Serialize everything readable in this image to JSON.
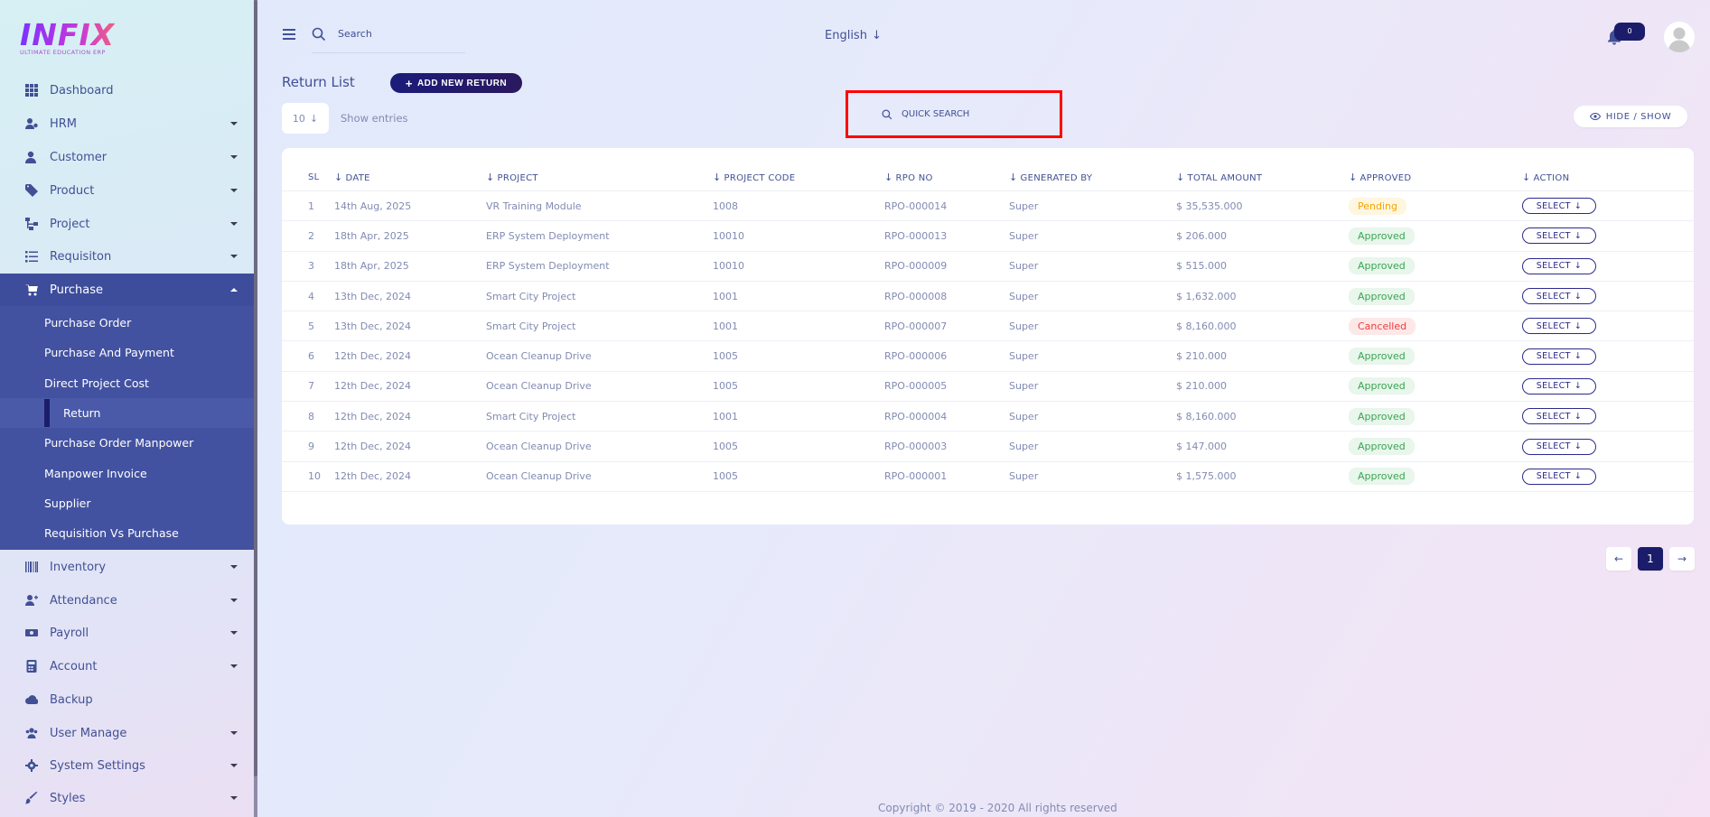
{
  "brand": {
    "logo_text": "INFIX",
    "tagline": "ULTIMATE EDUCATION ERP"
  },
  "header": {
    "search_placeholder": "Search",
    "language": "English",
    "notification_count": "0"
  },
  "sidebar": {
    "items": [
      {
        "label": "Dashboard",
        "icon": "grid-icon"
      },
      {
        "label": "HRM",
        "icon": "people-gear-icon"
      },
      {
        "label": "Customer",
        "icon": "user-icon"
      },
      {
        "label": "Product",
        "icon": "tag-icon"
      },
      {
        "label": "Project",
        "icon": "nodes-icon"
      },
      {
        "label": "Requisiton",
        "icon": "list-icon"
      },
      {
        "label": "Purchase",
        "icon": "cart-icon"
      },
      {
        "label": "Inventory",
        "icon": "barcode-icon"
      },
      {
        "label": "Attendance",
        "icon": "user-plus-icon"
      },
      {
        "label": "Payroll",
        "icon": "money-icon"
      },
      {
        "label": "Account",
        "icon": "calculator-icon"
      },
      {
        "label": "Backup",
        "icon": "cloud-icon"
      },
      {
        "label": "User Manage",
        "icon": "users-icon"
      },
      {
        "label": "System Settings",
        "icon": "gear-icon"
      },
      {
        "label": "Styles",
        "icon": "brush-icon"
      }
    ],
    "purchase_submenu": [
      {
        "label": "Purchase Order"
      },
      {
        "label": "Purchase And Payment"
      },
      {
        "label": "Direct Project Cost"
      },
      {
        "label": "Return"
      },
      {
        "label": "Purchase Order Manpower"
      },
      {
        "label": "Manpower Invoice"
      },
      {
        "label": "Supplier"
      },
      {
        "label": "Requisition Vs Purchase"
      }
    ]
  },
  "page": {
    "title": "Return List",
    "add_button": "ADD NEW RETURN",
    "entries_value": "10",
    "entries_label": "Show entries",
    "quick_search_placeholder": "QUICK SEARCH",
    "hide_show_label": "HIDE / SHOW"
  },
  "table": {
    "columns": [
      "SL",
      "DATE",
      "PROJECT",
      "PROJECT CODE",
      "RPO NO",
      "GENERATED BY",
      "TOTAL AMOUNT",
      "APPROVED",
      "ACTION"
    ],
    "action_label": "SELECT",
    "rows": [
      {
        "sl": "1",
        "date": "14th Aug, 2025",
        "project": "VR Training Module",
        "code": "1008",
        "rpo": "RPO-000014",
        "by": "Super",
        "amount": "$ 35,535.000",
        "status": "Pending"
      },
      {
        "sl": "2",
        "date": "18th Apr, 2025",
        "project": "ERP System Deployment",
        "code": "10010",
        "rpo": "RPO-000013",
        "by": "Super",
        "amount": "$ 206.000",
        "status": "Approved"
      },
      {
        "sl": "3",
        "date": "18th Apr, 2025",
        "project": "ERP System Deployment",
        "code": "10010",
        "rpo": "RPO-000009",
        "by": "Super",
        "amount": "$ 515.000",
        "status": "Approved"
      },
      {
        "sl": "4",
        "date": "13th Dec, 2024",
        "project": "Smart City Project",
        "code": "1001",
        "rpo": "RPO-000008",
        "by": "Super",
        "amount": "$ 1,632.000",
        "status": "Approved"
      },
      {
        "sl": "5",
        "date": "13th Dec, 2024",
        "project": "Smart City Project",
        "code": "1001",
        "rpo": "RPO-000007",
        "by": "Super",
        "amount": "$ 8,160.000",
        "status": "Cancelled"
      },
      {
        "sl": "6",
        "date": "12th Dec, 2024",
        "project": "Ocean Cleanup Drive",
        "code": "1005",
        "rpo": "RPO-000006",
        "by": "Super",
        "amount": "$ 210.000",
        "status": "Approved"
      },
      {
        "sl": "7",
        "date": "12th Dec, 2024",
        "project": "Ocean Cleanup Drive",
        "code": "1005",
        "rpo": "RPO-000005",
        "by": "Super",
        "amount": "$ 210.000",
        "status": "Approved"
      },
      {
        "sl": "8",
        "date": "12th Dec, 2024",
        "project": "Smart City Project",
        "code": "1001",
        "rpo": "RPO-000004",
        "by": "Super",
        "amount": "$ 8,160.000",
        "status": "Approved"
      },
      {
        "sl": "9",
        "date": "12th Dec, 2024",
        "project": "Ocean Cleanup Drive",
        "code": "1005",
        "rpo": "RPO-000003",
        "by": "Super",
        "amount": "$ 147.000",
        "status": "Approved"
      },
      {
        "sl": "10",
        "date": "12th Dec, 2024",
        "project": "Ocean Cleanup Drive",
        "code": "1005",
        "rpo": "RPO-000001",
        "by": "Super",
        "amount": "$ 1,575.000",
        "status": "Approved"
      }
    ]
  },
  "pagination": {
    "current": "1",
    "prev": "←",
    "next": "→"
  },
  "footer": {
    "text": "Copyright © 2019 - 2020 All rights reserved"
  },
  "colors": {
    "primary": "#415094",
    "submenu_bg": "#4352a0",
    "accent_dark": "#1b1d6a",
    "highlight_border": "#ff0000"
  }
}
